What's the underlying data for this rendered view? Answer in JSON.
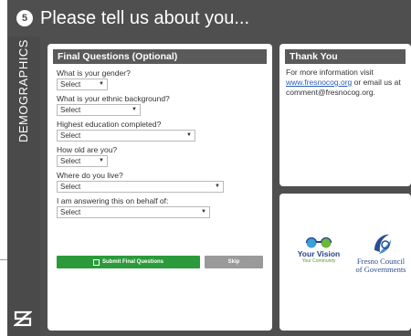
{
  "header": {
    "step_number": "5",
    "title": "Please tell us about you..."
  },
  "sidebar": {
    "section_label": "DEMOGRAPHICS",
    "logo_icon": "chevron-z-logo-icon"
  },
  "final_questions": {
    "heading": "Final Questions (Optional)",
    "questions": [
      {
        "label": "What is your gender?",
        "value": "Select"
      },
      {
        "label": "What is your ethnic background?",
        "value": "Select"
      },
      {
        "label": "Highest education completed?",
        "value": "Select"
      },
      {
        "label": "How old are you?",
        "value": "Select"
      },
      {
        "label": "Where do you live?",
        "value": "Select"
      },
      {
        "label": "I am answering this on behalf of:",
        "value": "Select"
      }
    ],
    "submit_label": "Submit Final Questions",
    "skip_label": "Skip"
  },
  "thank_you": {
    "heading": "Thank You",
    "text_prefix": "For more information visit",
    "link_text": "www.fresnocog.org",
    "text_suffix": " or email us at comment@fresnocog.org."
  },
  "logos": {
    "your_vision_title": "Your Vision",
    "your_vision_sub": "Your Community",
    "fresno_line1": "Fresno Council",
    "fresno_line2": "of Governments"
  },
  "colors": {
    "frame": "#4f4f4f",
    "submit_green": "#2a9a3a",
    "skip_gray": "#9a9a9a",
    "link_blue": "#2d5fb8"
  }
}
